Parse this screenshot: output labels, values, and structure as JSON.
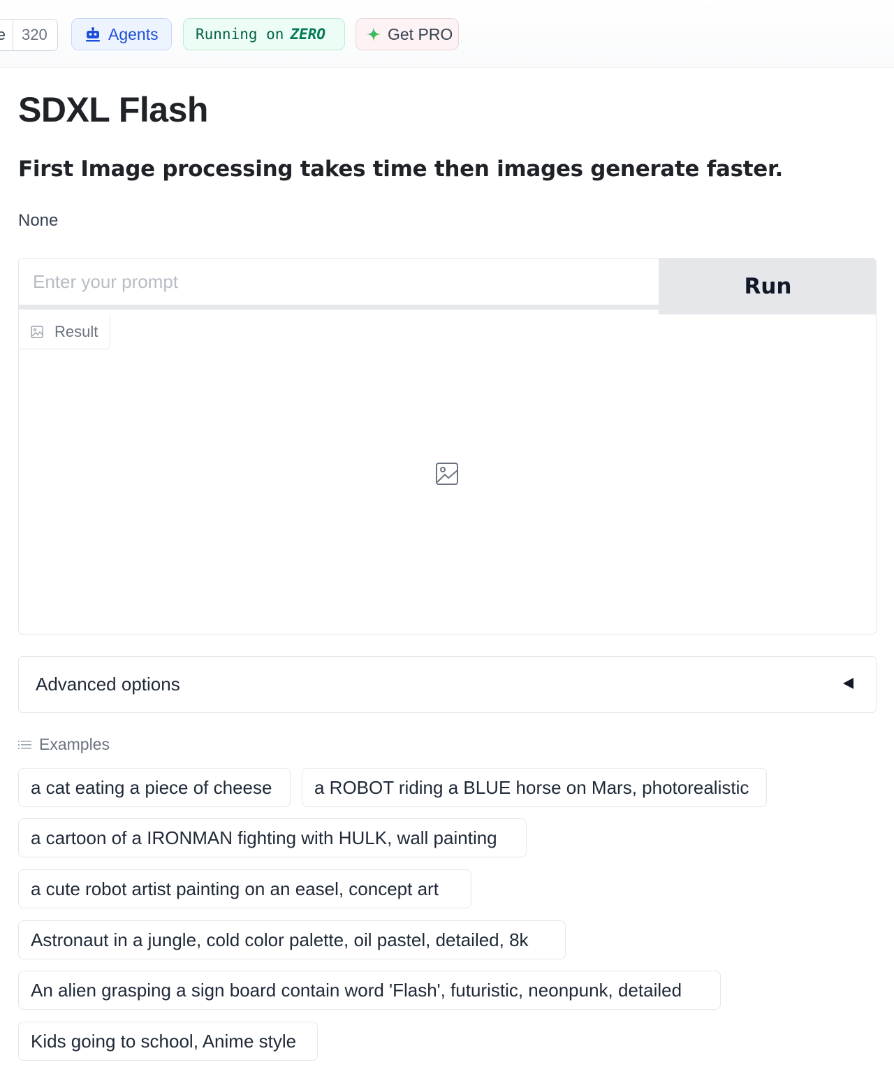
{
  "header": {
    "like_fragment": "e",
    "like_count": "320",
    "agents_label": "Agents",
    "running_prefix": "Running on",
    "running_zero": "ZERO",
    "pro_label": "Get PRO"
  },
  "main": {
    "title": "SDXL Flash",
    "subtitle": "First Image processing takes time then images generate faster.",
    "description": "None",
    "prompt_placeholder": "Enter your prompt",
    "prompt_value": "",
    "run_label": "Run",
    "result_label": "Result",
    "advanced_label": "Advanced options",
    "examples_label": "Examples",
    "examples": [
      "a cat eating a piece of cheese",
      "a ROBOT riding a BLUE horse on Mars, photorealistic",
      "a cartoon of a IRONMAN fighting with HULK, wall painting",
      "a cute robot artist painting on an easel, concept art",
      "Astronaut in a jungle, cold color palette, oil pastel, detailed, 8k",
      "An alien grasping a sign board contain word 'Flash', futuristic, neonpunk, detailed",
      "Kids going to school, Anime style"
    ]
  },
  "icons": {
    "agents": "robot-icon",
    "pro": "sparkle-icon",
    "result": "image-icon",
    "examples": "list-icon",
    "accordion": "caret-left-icon"
  },
  "colors": {
    "agents_blue": "#1d4ed8",
    "zero_green": "#047857",
    "run_bg": "#e5e7eb"
  }
}
